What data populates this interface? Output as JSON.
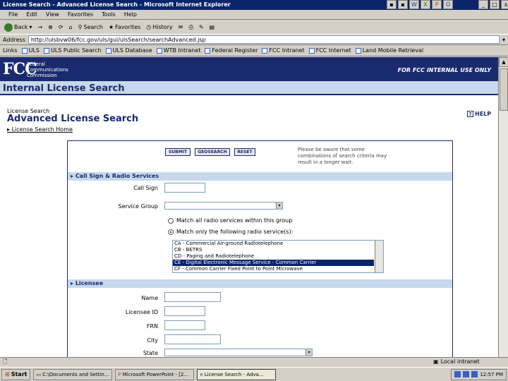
{
  "window": {
    "title": "License Search - Advanced License Search - Microsoft Internet Explorer",
    "controls": [
      "_",
      "□",
      "x"
    ]
  },
  "menu": [
    "File",
    "Edit",
    "View",
    "Favorites",
    "Tools",
    "Help"
  ],
  "toolbar": {
    "back": "Back",
    "search": "Search",
    "favorites": "Favorites",
    "history": "History"
  },
  "address": {
    "label": "Address",
    "value": "http://ulsbvw06/fcc.gov/uls/gui/ulsSearch/searchAdvanced.jsp"
  },
  "links": {
    "label": "Links",
    "items": [
      "ULS",
      "ULS Public Search",
      "ULS Database",
      "WTB Intranet",
      "Federal Register",
      "FCC Intranet",
      "FCC Internet",
      "Land Mobile Retrieval"
    ]
  },
  "banner": {
    "logo": "FCC",
    "name_lines": [
      "Federal",
      "Communications",
      "Commission"
    ],
    "internal_note": "FOR FCC INTERNAL USE ONLY",
    "app_title": "Internal License Search"
  },
  "page": {
    "breadcrumb": "License Search",
    "title": "Advanced License Search",
    "home_link": "License Search Home",
    "help": "HELP"
  },
  "form": {
    "buttons": [
      "SUBMIT",
      "GEOSEARCH",
      "RESET"
    ],
    "notice": "Please be aware that some combinations of search criteria may result in a longer wait.",
    "section1": "Call Sign & Radio Services",
    "callsign_label": "Call Sign",
    "callsign_value": "",
    "service_group_label": "Service Group",
    "service_group_value": "",
    "radio_all": "Match all radio services within this group",
    "radio_only": "Match only the following radio service(s):",
    "services": [
      "CA - Commercial Air-ground Radiotelephone",
      "CB - BETRS",
      "CD - Paging and Radiotelephone",
      "CE - Digital Electronic Message Service - Common Carrier",
      "CF - Common Carrier Fixed Point to Point Microwave"
    ],
    "selected_service_index": 3,
    "section2": "Licensee",
    "name_label": "Name",
    "licensee_id_label": "Licensee ID",
    "frn_label": "FRN",
    "city_label": "City",
    "state_label": "State"
  },
  "status": {
    "zone": "Local intranet"
  },
  "taskbar": {
    "start": "Start",
    "tasks": [
      "C:\\Documents and Settin...",
      "Microsoft PowerPoint - [2...",
      "License Search - Adva..."
    ],
    "clock": "12:57 PM"
  }
}
